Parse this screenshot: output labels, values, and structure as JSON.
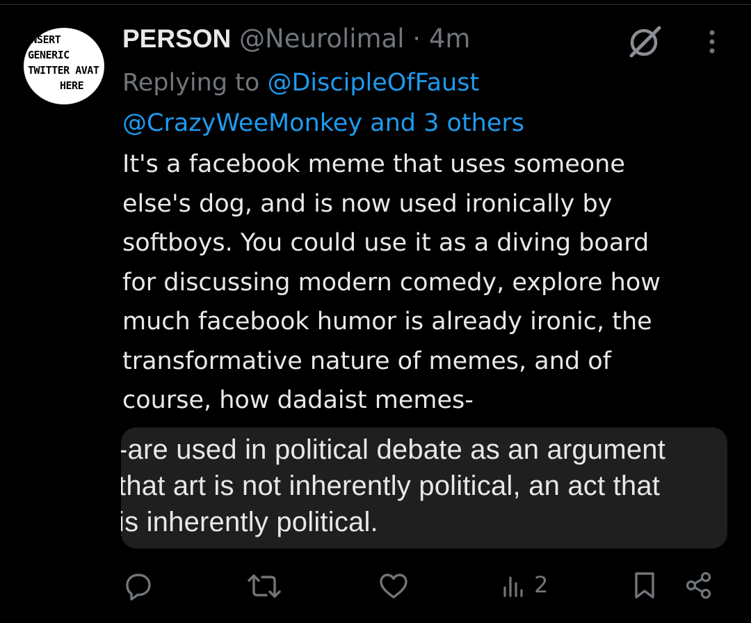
{
  "avatar": {
    "lines": [
      "INSERT",
      "GENERIC",
      "TWITTER AVAT",
      "HERE"
    ]
  },
  "tweet": {
    "display_name": "PERSON",
    "handle": "@Neurolimal",
    "separator": "·",
    "timestamp": "4m",
    "reply_prefix": "Replying to ",
    "reply_mention_1": "@DiscipleOfFaust",
    "reply_mention_2": "@CrazyWeeMonkey and 3 others",
    "body_lines": [
      "It's a facebook meme that uses someone",
      "else's dog, and is now used ironically by",
      "softboys. You could use it as a diving board",
      "for discussing modern comedy, explore how",
      "much facebook humor is already ironic, the",
      "transformative nature of memes, and of",
      "course, how dadaist memes-"
    ],
    "pasted_lines": [
      "-are used in political debate as an argument",
      "that art is not inherently political, an act that",
      "is inherently political."
    ]
  },
  "actions": {
    "views_count": "2"
  },
  "colors": {
    "background": "#000000",
    "primary_text": "#e7e9ea",
    "secondary_text": "#71767b",
    "link": "#1d9bf0",
    "pasted_bg": "#1f1f1f"
  },
  "icons": {
    "header_right": [
      "grok-icon",
      "more-options-icon"
    ],
    "action_bar": [
      "reply-icon",
      "retweet-icon",
      "like-icon",
      "views-icon",
      "bookmark-icon",
      "share-icon"
    ]
  }
}
